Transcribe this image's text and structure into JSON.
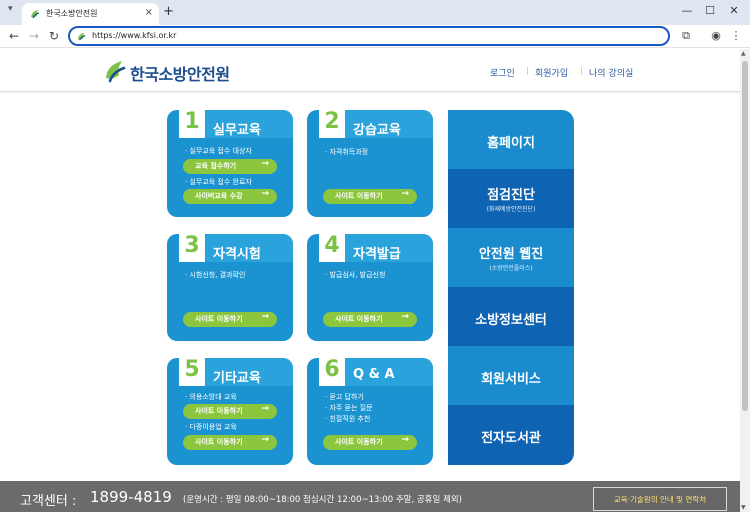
{
  "browser": {
    "tab_title": "한국소방안전원",
    "tab_close": "×",
    "new_tab": "+",
    "url": "https://www.kfsi.or.kr",
    "window_controls": {
      "minimize": "—",
      "maximize": "☐",
      "close": "✕"
    }
  },
  "header": {
    "logo_text": "한국소방안전원",
    "nav": [
      {
        "label": "로그인"
      },
      {
        "label": "회원가입"
      },
      {
        "label": "나의 강의실"
      }
    ],
    "brand_color": "#1d4f8f"
  },
  "cards": [
    {
      "number": "1",
      "title": "실무교육",
      "lines": [
        {
          "text": "· 실무교육 접수 대상자",
          "button": "교육 접수하기"
        },
        {
          "text": "· 실무교육 접수 완료자",
          "button": "사이버교육 수강"
        }
      ]
    },
    {
      "number": "2",
      "title": "강습교육",
      "lines": [
        {
          "text": "· 자격취득과정"
        }
      ],
      "button": "사이트 이동하기"
    },
    {
      "number": "3",
      "title": "자격시험",
      "lines": [
        {
          "text": "· 시험신청, 결과확인"
        }
      ],
      "button": "사이트 이동하기"
    },
    {
      "number": "4",
      "title": "자격발급",
      "lines": [
        {
          "text": "· 발급심사, 발급신청"
        }
      ],
      "button": "사이트 이동하기"
    },
    {
      "number": "5",
      "title": "기타교육",
      "lines": [
        {
          "text": "· 의용소방대 교육",
          "button": "사이트 이동하기"
        },
        {
          "text": "· 다중이용업 교육",
          "button": "사이트 이동하기"
        }
      ]
    },
    {
      "number": "6",
      "title": "Q & A",
      "lines": [
        {
          "text": "· 묻고 답하기"
        },
        {
          "text": "· 자주 묻는 질문"
        },
        {
          "text": "· 친절직원 추천"
        }
      ],
      "button": "사이트 이동하기"
    }
  ],
  "right_menu": [
    {
      "label": "홈페이지",
      "color": "#1a8ccd"
    },
    {
      "label": "점검진단",
      "sub": "(화재예방안전진단)",
      "color": "#0e63b3"
    },
    {
      "label": "안전원 웹진",
      "sub": "(소방안전플러스)",
      "color": "#1a8ccd"
    },
    {
      "label": "소방정보센터",
      "color": "#0e63b3"
    },
    {
      "label": "회원서비스",
      "color": "#1a8ccd"
    },
    {
      "label": "전자도서관",
      "color": "#0e63b3"
    }
  ],
  "footer": {
    "label": "고객센터 :",
    "phone": "1899-4819",
    "hours": "(운영시간 : 평일 08:00~18:00  점심시간 12:00~13:00  주말, 공휴일 제외)",
    "guide_button": "교육·기술원의 안내 및 연락처"
  },
  "colors": {
    "card_blue": "#1b93d1",
    "pill_green": "#8cc63e",
    "number_green": "#7cc245",
    "footer_gray": "#6b6b6b"
  }
}
